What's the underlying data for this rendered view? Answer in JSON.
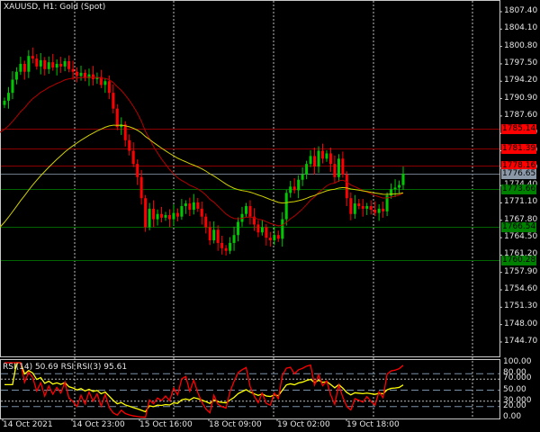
{
  "header": {
    "title": "XAUUSD, H1:  Gold (Spot)"
  },
  "rsi_header": "RSI(14) 50.69 RSI RSI(3) 95.61",
  "colors": {
    "bull": "#00c800",
    "bear": "#ff0000",
    "ma_fast": "#b40000",
    "ma_slow": "#d2d200",
    "rsi14": "#ffff00",
    "rsi3": "#ff0000",
    "red_line": "#8b0000",
    "green_line": "#006400",
    "red_tag": "#ff0000",
    "green_tag": "#008000",
    "price_tag": "#8a98a8"
  },
  "chart_data": {
    "type": "candlestick",
    "symbol": "XAUUSD",
    "timeframe": "H1",
    "price_ticks": [
      "1807.40",
      "1804.10",
      "1800.80",
      "1797.50",
      "1794.20",
      "1790.90",
      "1787.60",
      "1784.30",
      "1781.00",
      "1777.70",
      "1774.40",
      "1771.10",
      "1767.80",
      "1764.50",
      "1761.20",
      "1757.90",
      "1754.60",
      "1751.30",
      "1748.00",
      "1744.70"
    ],
    "ylim": [
      1743.5,
      1809.5
    ],
    "time_labels": [
      "14 Oct 2021",
      "14 Oct 23:00",
      "15 Oct 16:00",
      "18 Oct 09:00",
      "19 Oct 02:00",
      "19 Oct 18:00"
    ],
    "closes": [
      1790.5,
      1792,
      1794.5,
      1796,
      1797.5,
      1796,
      1799,
      1798.5,
      1797,
      1798.2,
      1796.5,
      1797.8,
      1796.8,
      1797.5,
      1797,
      1798,
      1796.5,
      1796,
      1795.2,
      1795.8,
      1794.8,
      1795.5,
      1794.6,
      1795,
      1793.5,
      1794.2,
      1792,
      1789,
      1785.5,
      1786,
      1783,
      1781,
      1778.5,
      1776,
      1772,
      1766.5,
      1770,
      1768,
      1769,
      1768.3,
      1768.8,
      1768,
      1769.2,
      1768.5,
      1770.5,
      1771,
      1769.8,
      1771.2,
      1770,
      1768.5,
      1766.5,
      1764,
      1766,
      1763.5,
      1762.5,
      1762,
      1763.5,
      1765,
      1767.5,
      1769,
      1770.5,
      1768.5,
      1767,
      1765.5,
      1766.5,
      1764.5,
      1764,
      1765,
      1764.3,
      1768,
      1773,
      1774.2,
      1773.5,
      1775.5,
      1776.5,
      1778.5,
      1780,
      1778,
      1781,
      1779.5,
      1780.5,
      1778.5,
      1776,
      1779.5,
      1776.5,
      1772,
      1769,
      1771,
      1770.5,
      1770,
      1770.5,
      1769.8,
      1769.2,
      1770,
      1769.5,
      1772.5,
      1773.7,
      1774,
      1774.5,
      1776.65
    ],
    "ma_fast_seed": 1784.5,
    "ma_slow_seed": 1766.5,
    "levels": [
      {
        "price": 1785.14,
        "label": "1785.14",
        "kind": "red"
      },
      {
        "price": 1781.39,
        "label": "1781.39",
        "kind": "red"
      },
      {
        "price": 1778.16,
        "label": "1778.16",
        "kind": "red"
      },
      {
        "price": 1776.65,
        "label": "1776.65",
        "kind": "price"
      },
      {
        "price": 1773.66,
        "label": "1773.66",
        "kind": "green"
      },
      {
        "price": 1766.54,
        "label": "1766.54",
        "kind": "green"
      },
      {
        "price": 1760.28,
        "label": "1760.28",
        "kind": "green"
      }
    ],
    "rsi": {
      "ticks": [
        "100.00",
        "80.00",
        "70.000",
        "50.00",
        "30.000",
        "20.00",
        "0.00"
      ],
      "tick_values": [
        100,
        80,
        70,
        50,
        30,
        20,
        0
      ],
      "rsi14": 50.69,
      "rsi3": 95.61
    }
  }
}
